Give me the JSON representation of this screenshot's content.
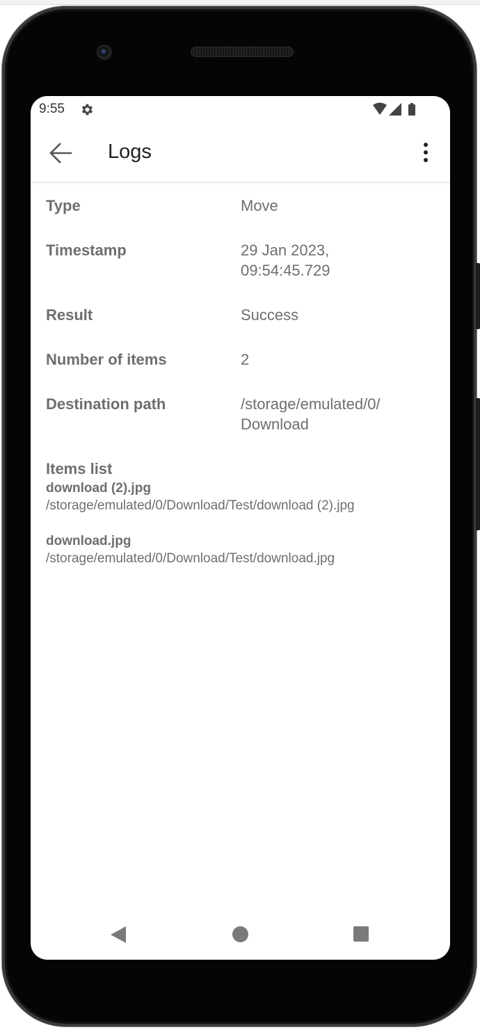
{
  "status_bar": {
    "time": "9:55",
    "settings_icon": "gear-icon",
    "wifi_icon": "wifi-icon",
    "signal_icon": "signal-icon",
    "battery_icon": "battery-icon"
  },
  "app_bar": {
    "back_icon": "arrow-left-icon",
    "title": "Logs",
    "menu_icon": "more-vert-icon"
  },
  "details": [
    {
      "label": "Type",
      "value": "Move"
    },
    {
      "label": "Timestamp",
      "value_lines": [
        "29 Jan 2023,",
        "09:54:45.729"
      ]
    },
    {
      "label": "Result",
      "value": "Success"
    },
    {
      "label": "Number of items",
      "value": "2"
    },
    {
      "label": "Destination path",
      "value_lines": [
        "/storage/emulated/0/",
        "Download"
      ]
    }
  ],
  "items_list": {
    "title": "Items list",
    "items": [
      {
        "name": "download (2).jpg",
        "path": "/storage/emulated/0/Download/Test/download (2).jpg"
      },
      {
        "name": "download.jpg",
        "path": "/storage/emulated/0/Download/Test/download.jpg"
      }
    ]
  },
  "nav_bar": {
    "back_icon": "nav-back-icon",
    "home_icon": "nav-home-icon",
    "recents_icon": "nav-recents-icon"
  },
  "colors": {
    "text_primary": "#202020",
    "text_secondary": "#6e6e6e",
    "screen_background": "#ffffff",
    "device_frame": "#050505"
  }
}
